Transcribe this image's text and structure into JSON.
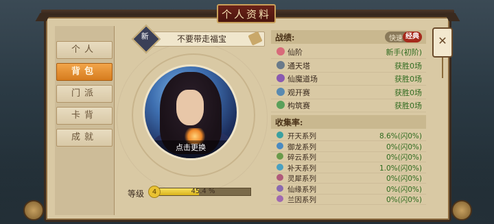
{
  "title": "个人资料",
  "sidebar": {
    "tabs": [
      {
        "label": "个人"
      },
      {
        "label": "背包"
      },
      {
        "label": "门派"
      },
      {
        "label": "卡背"
      },
      {
        "label": "成就"
      }
    ],
    "active_index": 1
  },
  "profile": {
    "badge": "新",
    "name": "不要带走福宝",
    "avatar_action": "点击更换",
    "level_label": "等级",
    "level": "4",
    "progress_text": "45.4 %",
    "progress_fraction": 0.454
  },
  "record": {
    "title": "战绩:",
    "mode_fast": "快速",
    "mode_classic": "经典",
    "rows": [
      {
        "label": "仙阶",
        "value": "新手(初阶)",
        "icon_color": "#d86a7a"
      },
      {
        "label": "通天塔",
        "value": "获胜0场",
        "icon_color": "#6a7a8a"
      },
      {
        "label": "仙魔道场",
        "value": "获胜0场",
        "icon_color": "#8a5ab0"
      },
      {
        "label": "观开赛",
        "value": "获胜0场",
        "icon_color": "#5a8ab0"
      },
      {
        "label": "构筑赛",
        "value": "获胜0场",
        "icon_color": "#5aa05a"
      }
    ]
  },
  "collection": {
    "title": "收集率:",
    "rows": [
      {
        "label": "开天系列",
        "value": "8.6%(闪0%)",
        "icon_color": "#3aa0a0"
      },
      {
        "label": "御龙系列",
        "value": "0%(闪0%)",
        "icon_color": "#4a8ac0"
      },
      {
        "label": "碎云系列",
        "value": "0%(闪0%)",
        "icon_color": "#6a9a4a"
      },
      {
        "label": "补天系列",
        "value": "1.0%(闪0%)",
        "icon_color": "#4aa0c0"
      },
      {
        "label": "灵犀系列",
        "value": "0%(闪0%)",
        "icon_color": "#b05a7a"
      },
      {
        "label": "仙缘系列",
        "value": "0%(闪0%)",
        "icon_color": "#8a6ab0"
      },
      {
        "label": "兰因系列",
        "value": "0%(闪0%)",
        "icon_color": "#a06ab0"
      }
    ]
  },
  "lantern_close": "✕"
}
